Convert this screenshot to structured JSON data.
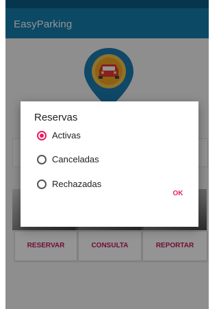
{
  "app": {
    "title": "EasyParking"
  },
  "actions": [
    {
      "label": "RESERVAR"
    },
    {
      "label": "CONSULTA"
    },
    {
      "label": "REPORTAR"
    }
  ],
  "dialog": {
    "title": "Reservas",
    "options": [
      {
        "label": "Activas",
        "selected": true
      },
      {
        "label": "Canceladas",
        "selected": false
      },
      {
        "label": "Rechazadas",
        "selected": false
      }
    ],
    "ok_label": "OK"
  },
  "colors": {
    "appbar": "#167fae",
    "accent": "#e91e63",
    "pin": "#1d7db3",
    "pin_badge": "#e53935"
  },
  "icons": [
    "car-location-pin-icon"
  ]
}
